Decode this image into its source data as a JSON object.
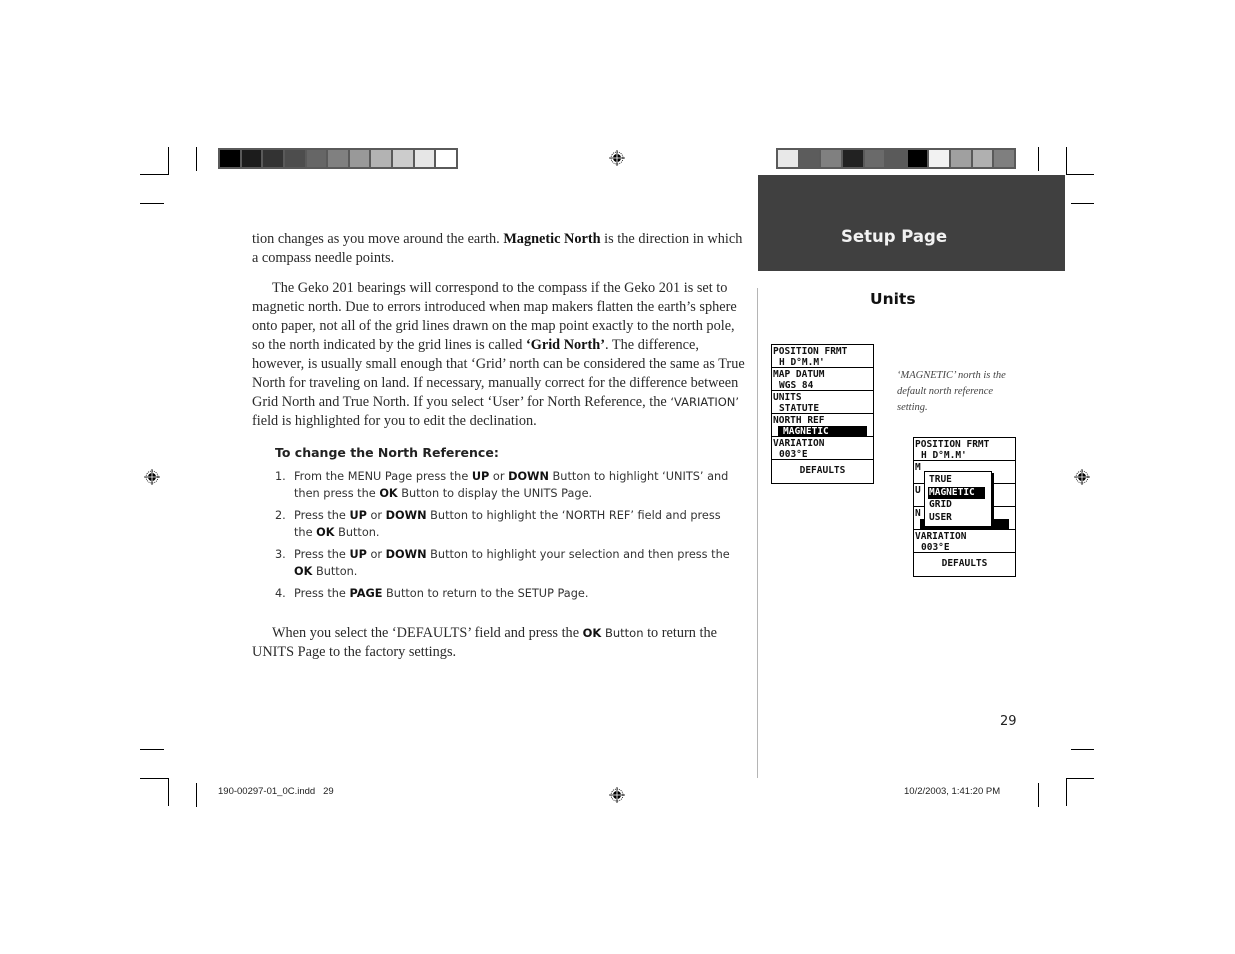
{
  "header": {
    "section_band": "Setup Page",
    "subsection_title": "Units"
  },
  "color_bars": {
    "left": [
      "#000000",
      "#1c1c1c",
      "#333333",
      "#4d4d4d",
      "#666666",
      "#808080",
      "#999999",
      "#b3b3b3",
      "#cccccc",
      "#e6e6e6",
      "#ffffff"
    ],
    "right": [
      "#e8e8e8",
      "#5c5c5c",
      "#808080",
      "#222222",
      "#6a6a6a",
      "#5a5a5a",
      "#000000",
      "#f2f2f2",
      "#a0a0a0",
      "#b0b0b0",
      "#7f7f7f"
    ]
  },
  "body": {
    "para1": {
      "t1": "tion changes as you move around the earth. ",
      "b1": "Magnetic North",
      "t2": " is the direction in which a compass needle points."
    },
    "para2": {
      "t1": "The Geko 201 bearings will correspond to the compass if the Geko 201 is set to magnetic north. Due to errors introduced when map makers flatten the earth’s sphere onto paper, not all of the grid lines drawn on the map point exactly to the north pole, so the north indicated by the grid lines is called ",
      "b1": "‘Grid North’",
      "t2": ". The difference, however, is usually small enough that ‘Grid’ north can be considered the same as True North for traveling on land. If necessary, manually correct for the difference between Grid North and True North. If you select ‘User’ for North Reference, the ",
      "s1": "‘VARIATION’",
      "t3": " field is highlighted for you to edit the declination."
    },
    "procedure_title": "To change the North Reference:",
    "steps": [
      {
        "num": "1.",
        "parts": [
          "From the MENU Page press the ",
          "UP",
          " or ",
          "DOWN",
          " Button to highlight ‘UNITS’ and then press the ",
          "OK",
          " Button to display the UNITS Page."
        ]
      },
      {
        "num": "2.",
        "parts": [
          "Press the ",
          "UP",
          " or ",
          "DOWN",
          " Button to highlight the ‘NORTH REF’ field and press the ",
          "OK",
          " Button."
        ]
      },
      {
        "num": "3.",
        "parts": [
          "Press the ",
          "UP",
          " or ",
          "DOWN",
          " Button to highlight your selection and then press the ",
          "OK",
          " Button."
        ]
      },
      {
        "num": "4.",
        "parts": [
          "Press the ",
          "PAGE",
          " Button to return to the SETUP Page."
        ]
      }
    ],
    "para3": {
      "t1": "When you select the ‘DEFAULTS’ field and press the ",
      "b1": "OK",
      "t2": " Button to return the UNITS Page to the factory settings."
    }
  },
  "caption": "‘MAGNETIC’ north is the default north reference setting.",
  "screen1": {
    "fields": [
      {
        "label": "POSITION FRMT",
        "value": "H D°M.M'"
      },
      {
        "label": "MAP DATUM",
        "value": "WGS 84"
      },
      {
        "label": "UNITS",
        "value": "STATUTE"
      },
      {
        "label": "NORTH REF",
        "value": "MAGNETIC",
        "highlighted": true
      },
      {
        "label": "VARIATION",
        "value": "003°E"
      }
    ],
    "defaults": "DEFAULTS"
  },
  "screen2": {
    "fields": [
      {
        "label": "POSITION FRMT",
        "value": "H D°M.M'"
      },
      {
        "label": "M",
        "value": ""
      },
      {
        "label": "U",
        "value": ""
      },
      {
        "label": "N",
        "value": "MAGNETIC",
        "highlighted": true
      },
      {
        "label": "VARIATION",
        "value": "003°E"
      }
    ],
    "defaults": "DEFAULTS",
    "popup_options": [
      "TRUE",
      "MAGNETIC",
      "GRID",
      "USER"
    ],
    "popup_selected": "MAGNETIC"
  },
  "page_number": "29",
  "slug": {
    "file": "190-00297-01_0C.indd   29",
    "timestamp": "10/2/2003, 1:41:20 PM"
  }
}
